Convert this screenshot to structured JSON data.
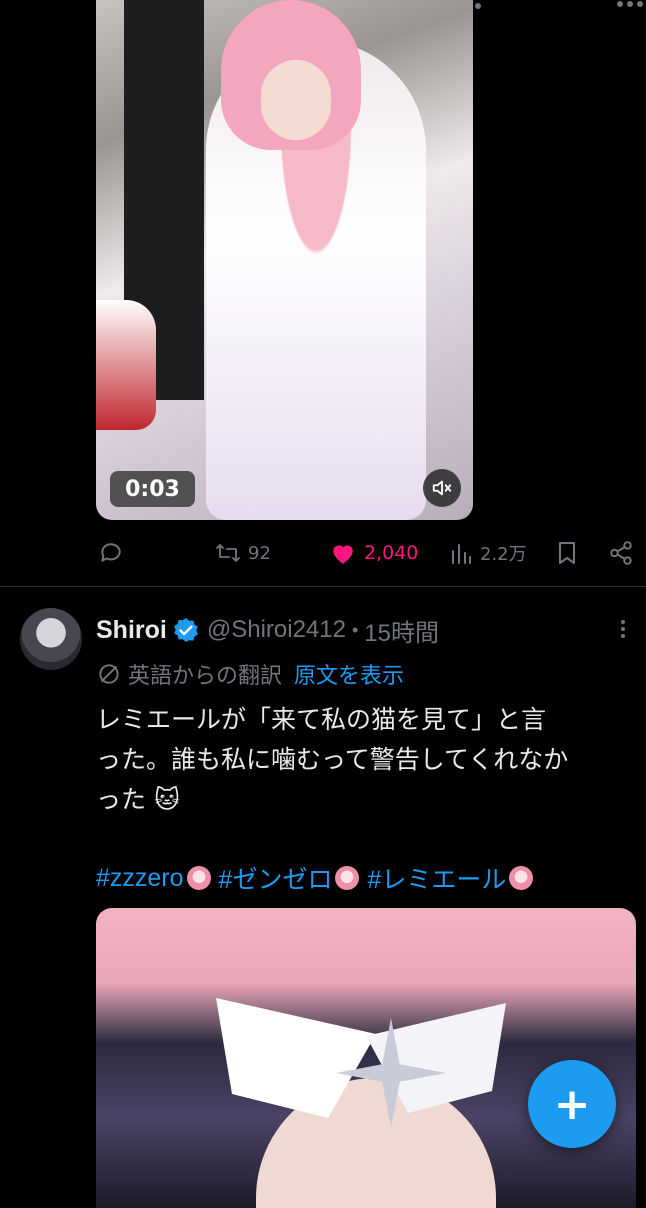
{
  "video": {
    "duration": "0:03"
  },
  "actions": {
    "reply_count": "",
    "repost_count": "92",
    "like_count": "2,040",
    "view_count": "2.2万",
    "liked_color": "#f91880"
  },
  "tweet": {
    "display_name": "Shiroi",
    "handle": "@Shiroi2412",
    "separator": "•",
    "time": "15時間",
    "translation_label": "英語からの翻訳",
    "show_original": "原文を表示",
    "text_lines": [
      "レミエールが「来て私の猫を見て」と言",
      "った。誰も私に噛むって警告してくれなか",
      "った 🐱"
    ],
    "hashtags": [
      "#zzzero",
      "#ゼンゼロ",
      "#レミエール"
    ]
  },
  "fab": {
    "label": "+"
  },
  "colors": {
    "accent": "#1d9bf0",
    "secondary_text": "#71767b",
    "background": "#000000"
  }
}
